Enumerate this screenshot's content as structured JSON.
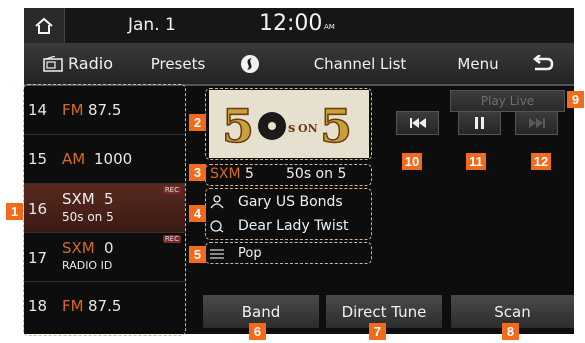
{
  "status": {
    "date": "Jan.  1",
    "time": "12:00",
    "ampm": "AM"
  },
  "nav": {
    "radio_label": "Radio",
    "presets_label": "Presets",
    "channel_list_label": "Channel List",
    "menu_label": "Menu"
  },
  "presets": [
    {
      "num": "14",
      "band": "FM",
      "freq": "87.5",
      "sub": ""
    },
    {
      "num": "15",
      "band": "AM",
      "freq": "1000",
      "sub": ""
    },
    {
      "num": "16",
      "band": "SXM",
      "freq": "5",
      "sub": "50s on 5",
      "rec": "REC"
    },
    {
      "num": "17",
      "band": "SXM",
      "freq": "0",
      "sub": "RADIO ID",
      "rec": "REC"
    },
    {
      "num": "18",
      "band": "FM",
      "freq": "87.5",
      "sub": ""
    }
  ],
  "now_playing": {
    "band": "SXM",
    "channel": "5",
    "channel_name": "50s on 5",
    "artist": "Gary US Bonds",
    "title": "Dear Lady Twist",
    "genre": "Pop",
    "logo_text": "5 ON 5"
  },
  "controls": {
    "play_live_label": "Play Live"
  },
  "bottom_buttons": {
    "band_label": "Band",
    "direct_tune_label": "Direct Tune",
    "scan_label": "Scan"
  },
  "callouts": [
    "1",
    "2",
    "3",
    "4",
    "5",
    "6",
    "7",
    "8",
    "9",
    "10",
    "11",
    "12"
  ],
  "colors": {
    "accent": "#f26a1b",
    "band_text": "#d86a1e",
    "selected_row": "#4a2219",
    "background": "#0d0d0e"
  }
}
